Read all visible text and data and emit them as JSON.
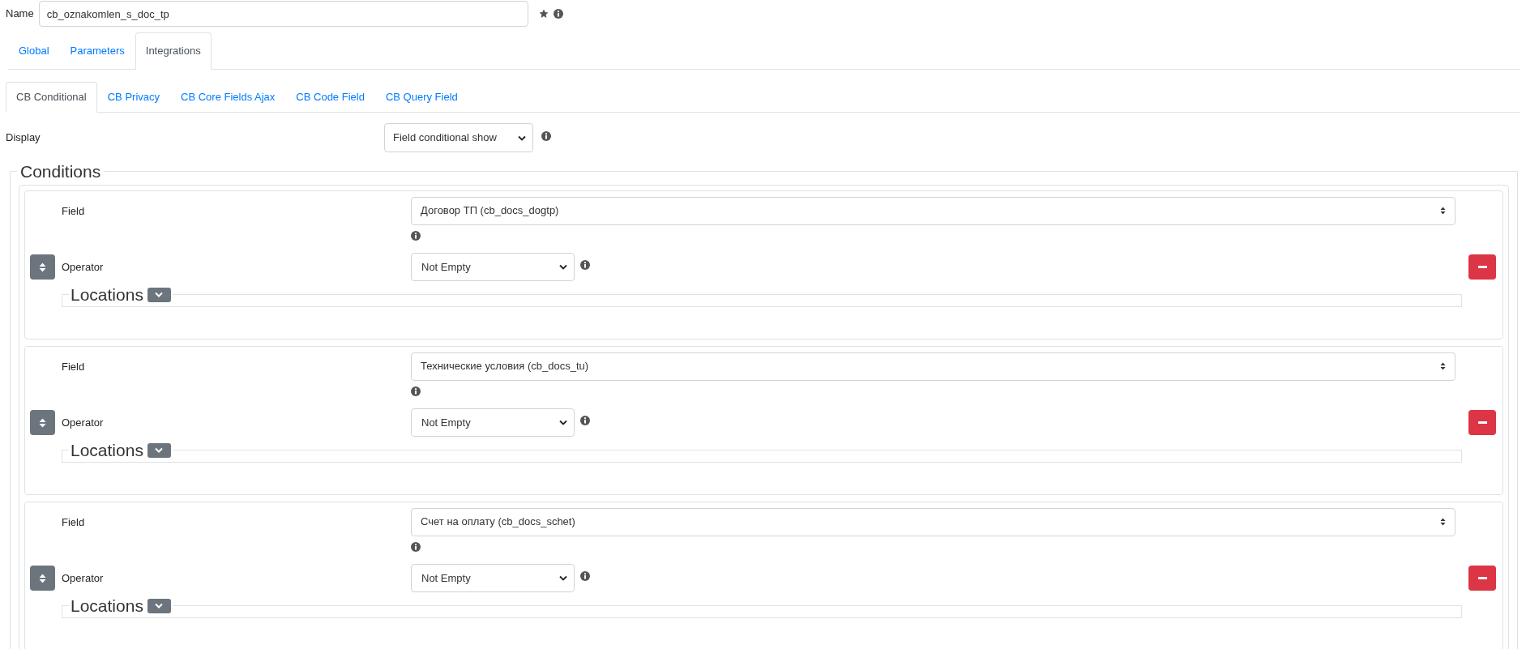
{
  "name_field": {
    "label": "Name",
    "value": "cb_oznakomlen_s_doc_tp"
  },
  "tabs": [
    {
      "label": "Global",
      "selected": false
    },
    {
      "label": "Parameters",
      "selected": false
    },
    {
      "label": "Integrations",
      "selected": true
    }
  ],
  "subtabs": [
    {
      "label": "CB Conditional",
      "selected": true
    },
    {
      "label": "CB Privacy",
      "selected": false
    },
    {
      "label": "CB Core Fields Ajax",
      "selected": false
    },
    {
      "label": "CB Code Field",
      "selected": false
    },
    {
      "label": "CB Query Field",
      "selected": false
    }
  ],
  "display": {
    "label": "Display",
    "value": "Field conditional show"
  },
  "conditions": {
    "legend": "Conditions",
    "items": [
      {
        "field_label": "Field",
        "field_value": "Договор ТП (cb_docs_dogtp)",
        "operator_label": "Operator",
        "operator_value": "Not Empty",
        "locations_legend": "Locations"
      },
      {
        "field_label": "Field",
        "field_value": "Технические условия (cb_docs_tu)",
        "operator_label": "Operator",
        "operator_value": "Not Empty",
        "locations_legend": "Locations"
      },
      {
        "field_label": "Field",
        "field_value": "Счет на оплату (cb_docs_schet)",
        "operator_label": "Operator",
        "operator_value": "Not Empty",
        "locations_legend": "Locations"
      }
    ]
  }
}
